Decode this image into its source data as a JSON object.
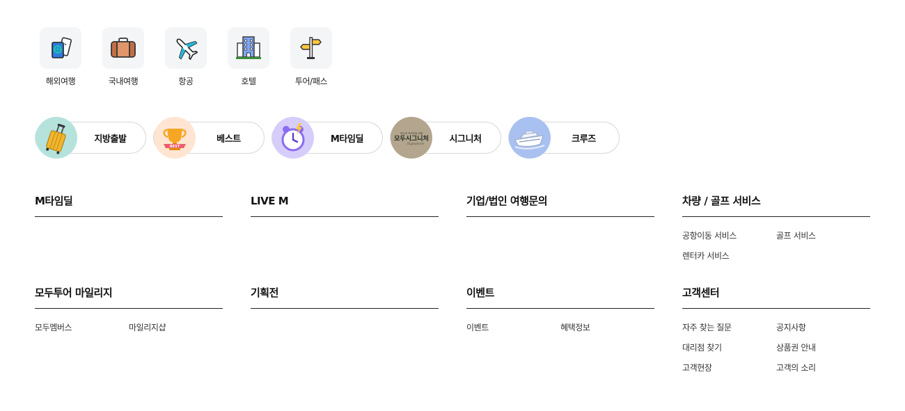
{
  "categories": [
    {
      "label": "해외여행",
      "icon": "passport-icon"
    },
    {
      "label": "국내여행",
      "icon": "suitcase-icon"
    },
    {
      "label": "항공",
      "icon": "airplane-icon"
    },
    {
      "label": "호텔",
      "icon": "hotel-building-icon"
    },
    {
      "label": "투어/패스",
      "icon": "signpost-icon"
    }
  ],
  "pills": [
    {
      "label": "지방출발",
      "icon": "luggage-icon",
      "bg": "#b5e3dc"
    },
    {
      "label": "베스트",
      "icon": "best-trophy-icon",
      "bg": "#ffe5d2"
    },
    {
      "label": "M타임딜",
      "icon": "alarm-clock-icon",
      "bg": "#d6cdfb"
    },
    {
      "label": "시그니처",
      "icon": "signature-logo-icon",
      "bg": "#b4a68e",
      "logo_small": "모두의 프리미엄 여행",
      "logo_main": "모두시그니처",
      "logo_script": "Signature"
    },
    {
      "label": "크루즈",
      "icon": "cruise-ship-icon",
      "bg": "#a9c1f0"
    }
  ],
  "sections": {
    "mtimedeal": {
      "title": "M타임딜",
      "links": []
    },
    "livem": {
      "title": "LIVE M",
      "links": []
    },
    "corporate": {
      "title": "기업/법인 여행문의",
      "links": []
    },
    "vehicle": {
      "title": "차량 / 골프 서비스",
      "links": [
        "공항이동 서비스",
        "골프 서비스",
        "렌터카 서비스"
      ]
    },
    "mileage": {
      "title": "모두투어 마일리지",
      "links": [
        "모두멤버스",
        "마일리지샵"
      ]
    },
    "exhibition": {
      "title": "기획전",
      "links": []
    },
    "event": {
      "title": "이벤트",
      "links": [
        "이벤트",
        "혜택정보"
      ]
    },
    "support": {
      "title": "고객센터",
      "links": [
        "자주 찾는 질문",
        "공지사항",
        "대리점 찾기",
        "상품권 안내",
        "고객현장",
        "고객의 소리"
      ]
    }
  },
  "colors": {
    "rule": "#222222",
    "pill_border": "#d8d8d8",
    "icon_box": "#f4f5f7"
  }
}
